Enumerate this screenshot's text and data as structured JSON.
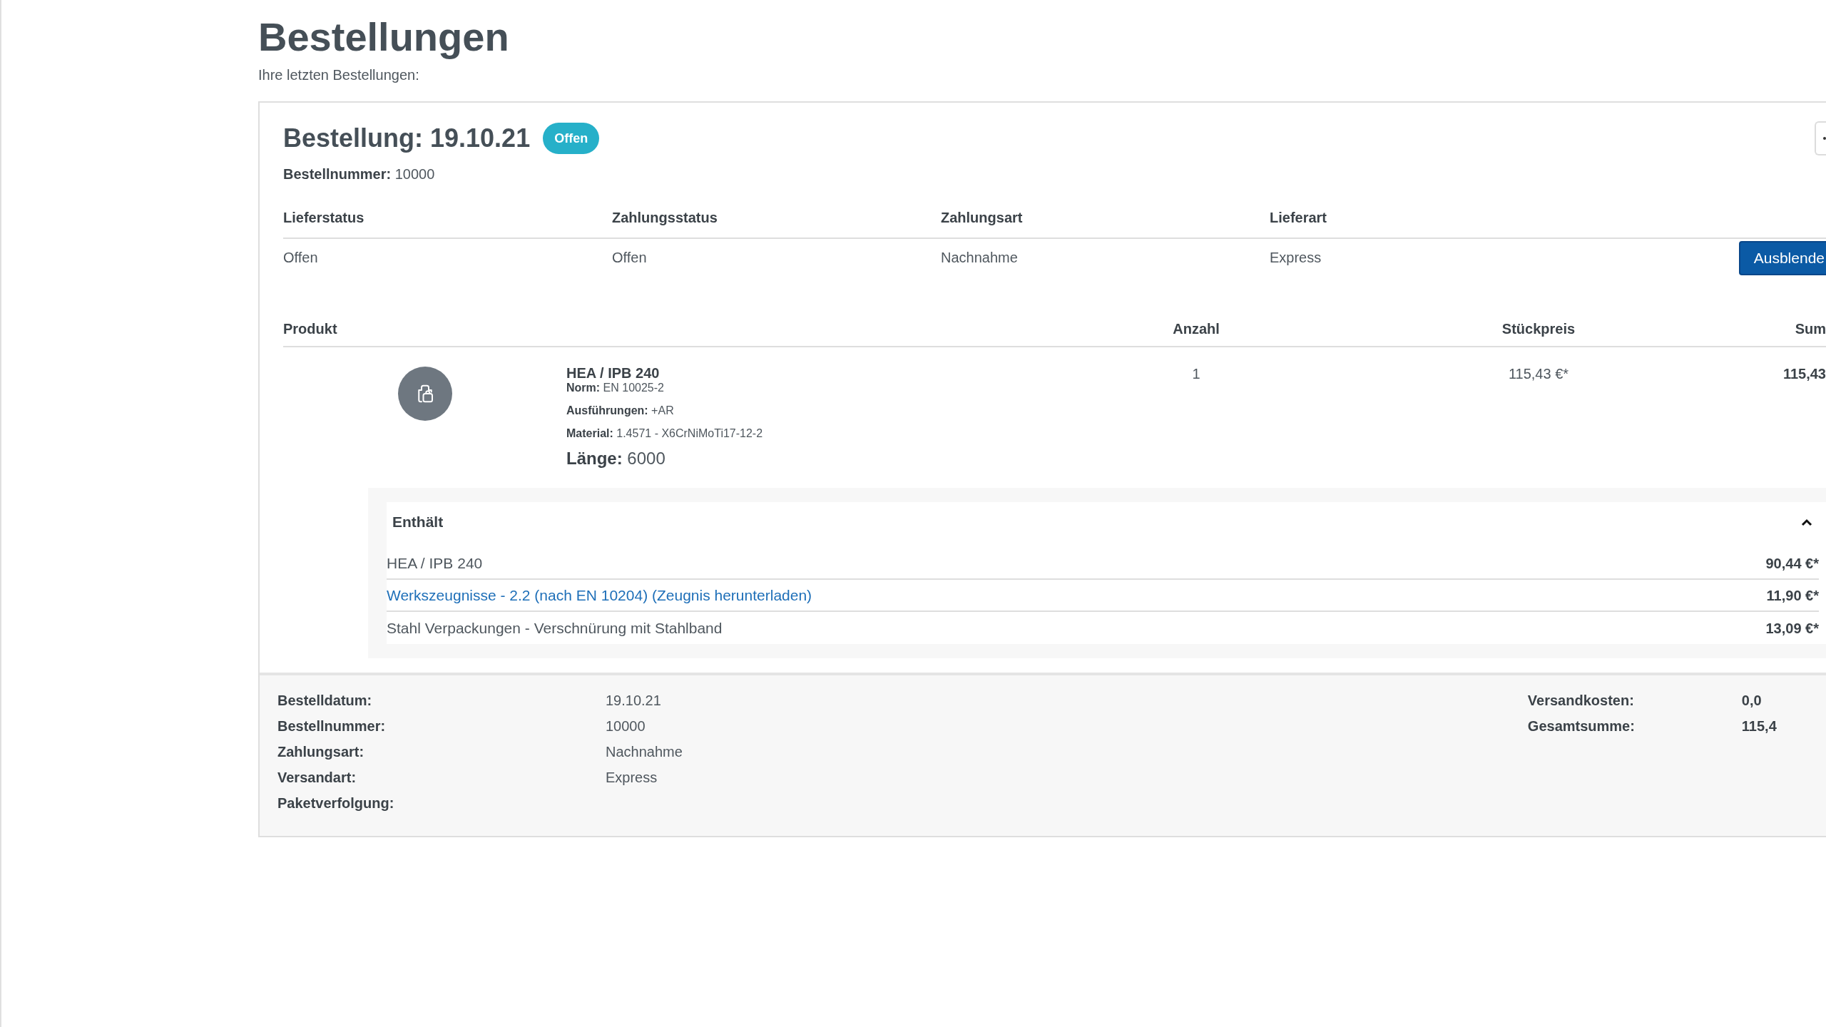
{
  "page": {
    "title": "Bestellungen",
    "subtitle": "Ihre letzten Bestellungen:"
  },
  "order": {
    "title": "Bestellung: 19.10.21",
    "status_badge": "Offen",
    "order_number_label": "Bestellnummer:",
    "order_number": "10000",
    "info_columns": [
      {
        "label": "Lieferstatus",
        "value": "Offen"
      },
      {
        "label": "Zahlungsstatus",
        "value": "Offen"
      },
      {
        "label": "Zahlungsart",
        "value": "Nachnahme"
      },
      {
        "label": "Lieferart",
        "value": "Express"
      }
    ],
    "toggle_button": "Ausblende",
    "product_table": {
      "columns": [
        "Produkt",
        "Anzahl",
        "Stückpreis",
        "Sum"
      ],
      "rows": [
        {
          "name": "HEA / IPB 240",
          "attributes": [
            {
              "label": "Norm:",
              "value": "EN 10025-2"
            },
            {
              "label": "Ausführungen:",
              "value": "+AR"
            },
            {
              "label": "Material:",
              "value": "1.4571 - X6CrNiMoTi17-12-2"
            }
          ],
          "length_label": "Länge:",
          "length": "6000",
          "quantity": "1",
          "unit_price": "115,43 €*",
          "total": "115,43",
          "contents": {
            "title": "Enthält",
            "expanded": true,
            "items": [
              {
                "kind": "text",
                "name": "HEA / IPB 240",
                "price": "90,44 €*"
              },
              {
                "kind": "link",
                "name": "Werkszeugnisse - 2.2 (nach EN 10204) (Zeugnis herunterladen)",
                "price": "11,90 €*"
              },
              {
                "kind": "text",
                "name": "Stahl Verpackungen - Verschnürung mit Stahlband",
                "price": "13,09 €*"
              }
            ]
          }
        }
      ]
    },
    "summary": {
      "left": [
        {
          "label": "Bestelldatum:",
          "value": "19.10.21"
        },
        {
          "label": "Bestellnummer:",
          "value": "10000"
        },
        {
          "label": "Zahlungsart:",
          "value": "Nachnahme"
        },
        {
          "label": "Versandart:",
          "value": "Express"
        },
        {
          "label": "Paketverfolgung:"
        }
      ],
      "right": [
        {
          "label": "Versandkosten:",
          "value": "0,0"
        },
        {
          "label": "Gesamtsumme:",
          "value": "115,4"
        }
      ]
    }
  }
}
